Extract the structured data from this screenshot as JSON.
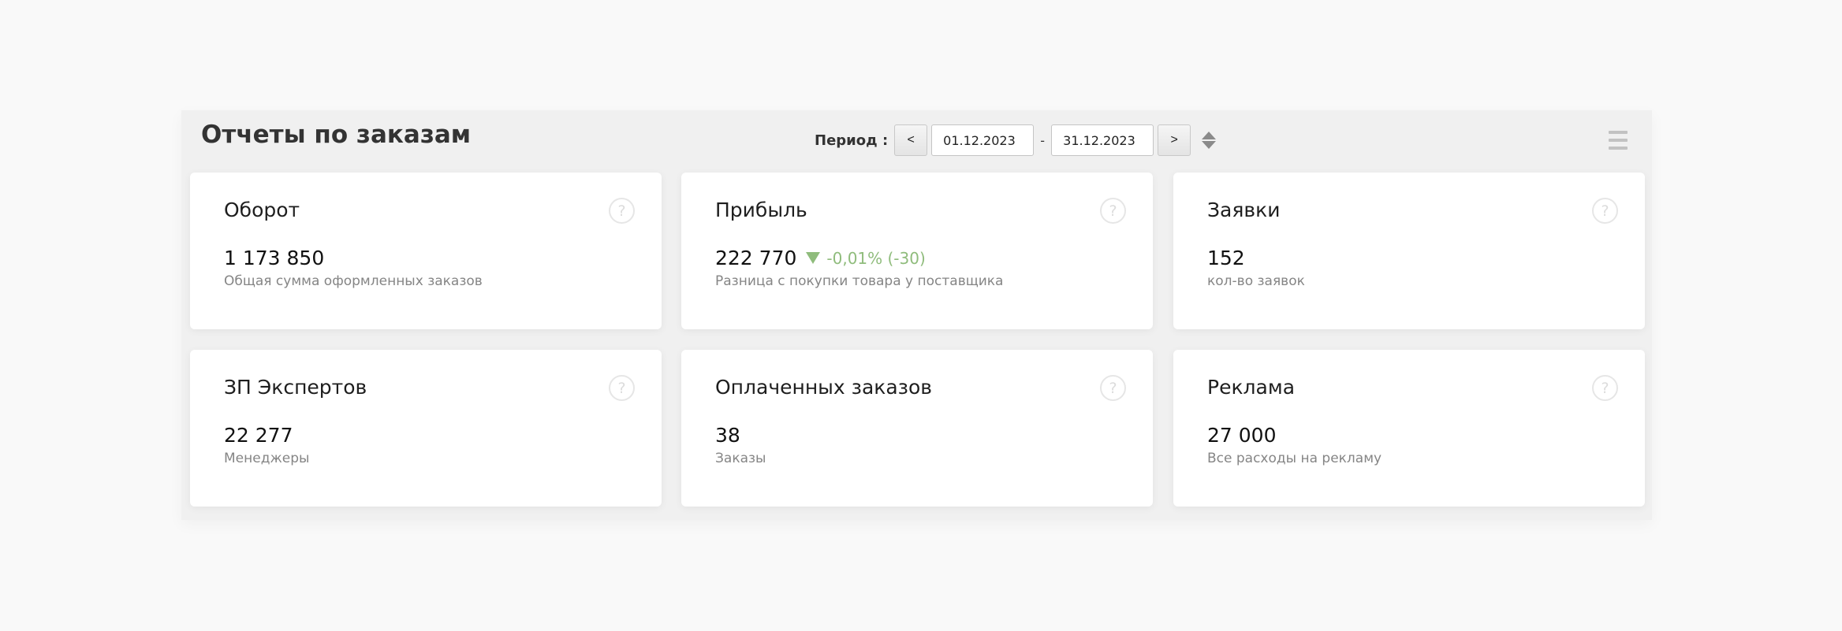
{
  "header": {
    "title": "Отчеты по заказам",
    "period_label": "Период :",
    "prev_label": "<",
    "next_label": ">",
    "date_from": "01.12.2023",
    "date_separator": "-",
    "date_to": "31.12.2023"
  },
  "cards": [
    {
      "title": "Оборот",
      "value": "1 173 850",
      "description": "Общая сумма оформленных заказов",
      "help": "?"
    },
    {
      "title": "Прибыль",
      "value": "222 770",
      "trend": "-0,01% (-30)",
      "trend_direction": "down",
      "description": "Разница с покупки товара у поставщика",
      "help": "?"
    },
    {
      "title": "Заявки",
      "value": "152",
      "description": "кол-во заявок",
      "help": "?"
    },
    {
      "title": "ЗП Экспертов",
      "value": "22 277",
      "description": "Менеджеры",
      "help": "?"
    },
    {
      "title": "Оплаченных заказов",
      "value": "38",
      "description": "Заказы",
      "help": "?"
    },
    {
      "title": "Реклама",
      "value": "27 000",
      "description": "Все расходы на рекламу",
      "help": "?"
    }
  ],
  "colors": {
    "trend": "#8fbc7c",
    "background": "#f9f9f9",
    "card": "#ffffff"
  },
  "icons": {
    "help": "question-circle-icon",
    "sort": "sort-icon",
    "menu": "hamburger-menu-icon",
    "trend": "triangle-down-icon"
  }
}
